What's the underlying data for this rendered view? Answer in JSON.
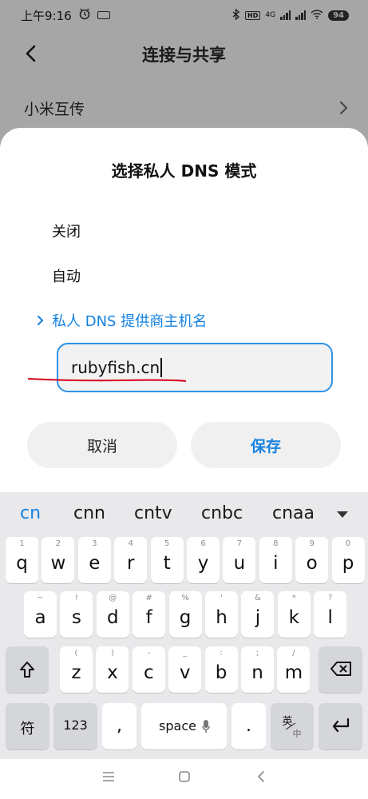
{
  "status_bar": {
    "time": "上午9:16",
    "network_type": "4G",
    "hd_badge": "HD",
    "battery": "94"
  },
  "header": {
    "title": "连接与共享"
  },
  "background_row": {
    "label": "小米互传"
  },
  "dialog": {
    "title": "选择私人 DNS 模式",
    "options": {
      "off": "关闭",
      "auto": "自动",
      "private": "私人 DNS 提供商主机名"
    },
    "hostname_value": "rubyfish.cn",
    "cancel_label": "取消",
    "save_label": "保存",
    "accent_color": "#1582e0",
    "annotation_color": "#d8001b"
  },
  "keyboard": {
    "suggestions": [
      "cn",
      "cnn",
      "cntv",
      "cnbc",
      "cnaa"
    ],
    "row1": [
      {
        "key": "q",
        "sub": "1"
      },
      {
        "key": "w",
        "sub": "2"
      },
      {
        "key": "e",
        "sub": "3"
      },
      {
        "key": "r",
        "sub": "4"
      },
      {
        "key": "t",
        "sub": "5"
      },
      {
        "key": "y",
        "sub": "6"
      },
      {
        "key": "u",
        "sub": "7"
      },
      {
        "key": "i",
        "sub": "8"
      },
      {
        "key": "o",
        "sub": "9"
      },
      {
        "key": "p",
        "sub": "0"
      }
    ],
    "row2": [
      {
        "key": "a",
        "sub": "~"
      },
      {
        "key": "s",
        "sub": "!"
      },
      {
        "key": "d",
        "sub": "@"
      },
      {
        "key": "f",
        "sub": "#"
      },
      {
        "key": "g",
        "sub": "%"
      },
      {
        "key": "h",
        "sub": "'"
      },
      {
        "key": "j",
        "sub": "&"
      },
      {
        "key": "k",
        "sub": "*"
      },
      {
        "key": "l",
        "sub": "?"
      }
    ],
    "row3": [
      {
        "key": "z",
        "sub": "("
      },
      {
        "key": "x",
        "sub": ")"
      },
      {
        "key": "c",
        "sub": "-"
      },
      {
        "key": "v",
        "sub": "_"
      },
      {
        "key": "b",
        "sub": ":"
      },
      {
        "key": "n",
        "sub": ";"
      },
      {
        "key": "m",
        "sub": "/"
      }
    ],
    "symbols_label": "符",
    "numbers_label": "123",
    "comma_label": ",",
    "space_label": "space",
    "period_label": ".",
    "lang_top": "英",
    "lang_bottom": "中"
  }
}
